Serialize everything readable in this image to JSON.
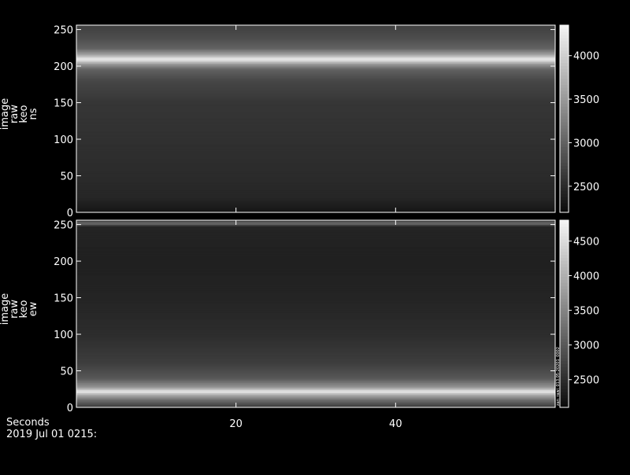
{
  "x_axis_title": "Seconds",
  "timestamp": "2019 Jul 01 0215:",
  "chart_data": [
    {
      "type": "heatmap",
      "ylabel_lines": [
        "image",
        "raw",
        "keo",
        "ns"
      ],
      "xlim": [
        0,
        60
      ],
      "ylim": [
        0,
        256
      ],
      "yticks": [
        0,
        50,
        100,
        150,
        200,
        250
      ],
      "colorbar": {
        "range": [
          2200,
          4350
        ],
        "ticks": [
          2500,
          3000,
          3500,
          4000
        ]
      },
      "profile": [
        {
          "y": 0,
          "v": 2300
        },
        {
          "y": 20,
          "v": 2450
        },
        {
          "y": 50,
          "v": 2500
        },
        {
          "y": 100,
          "v": 2550
        },
        {
          "y": 150,
          "v": 2600
        },
        {
          "y": 180,
          "v": 2750
        },
        {
          "y": 196,
          "v": 3000
        },
        {
          "y": 203,
          "v": 3500
        },
        {
          "y": 210,
          "v": 4300
        },
        {
          "y": 216,
          "v": 3600
        },
        {
          "y": 225,
          "v": 3000
        },
        {
          "y": 240,
          "v": 2800
        },
        {
          "y": 256,
          "v": 2700
        }
      ]
    },
    {
      "type": "heatmap",
      "ylabel_lines": [
        "image",
        "raw",
        "keo",
        "ew"
      ],
      "xlim": [
        0,
        60
      ],
      "ylim": [
        0,
        256
      ],
      "yticks": [
        0,
        50,
        100,
        150,
        200,
        250
      ],
      "colorbar": {
        "range": [
          2100,
          4800
        ],
        "ticks": [
          2500,
          3000,
          3500,
          4000,
          4500
        ],
        "side_label": "zan_rawi_013.05-20201_0002"
      },
      "profile": [
        {
          "y": 0,
          "v": 2600
        },
        {
          "y": 10,
          "v": 3200
        },
        {
          "y": 18,
          "v": 4000
        },
        {
          "y": 22,
          "v": 4700
        },
        {
          "y": 28,
          "v": 3700
        },
        {
          "y": 40,
          "v": 3000
        },
        {
          "y": 60,
          "v": 2700
        },
        {
          "y": 100,
          "v": 2500
        },
        {
          "y": 150,
          "v": 2400
        },
        {
          "y": 200,
          "v": 2350
        },
        {
          "y": 248,
          "v": 2400
        },
        {
          "y": 252,
          "v": 3300
        },
        {
          "y": 256,
          "v": 2600
        }
      ]
    }
  ],
  "x_ticks": [
    20,
    40
  ]
}
